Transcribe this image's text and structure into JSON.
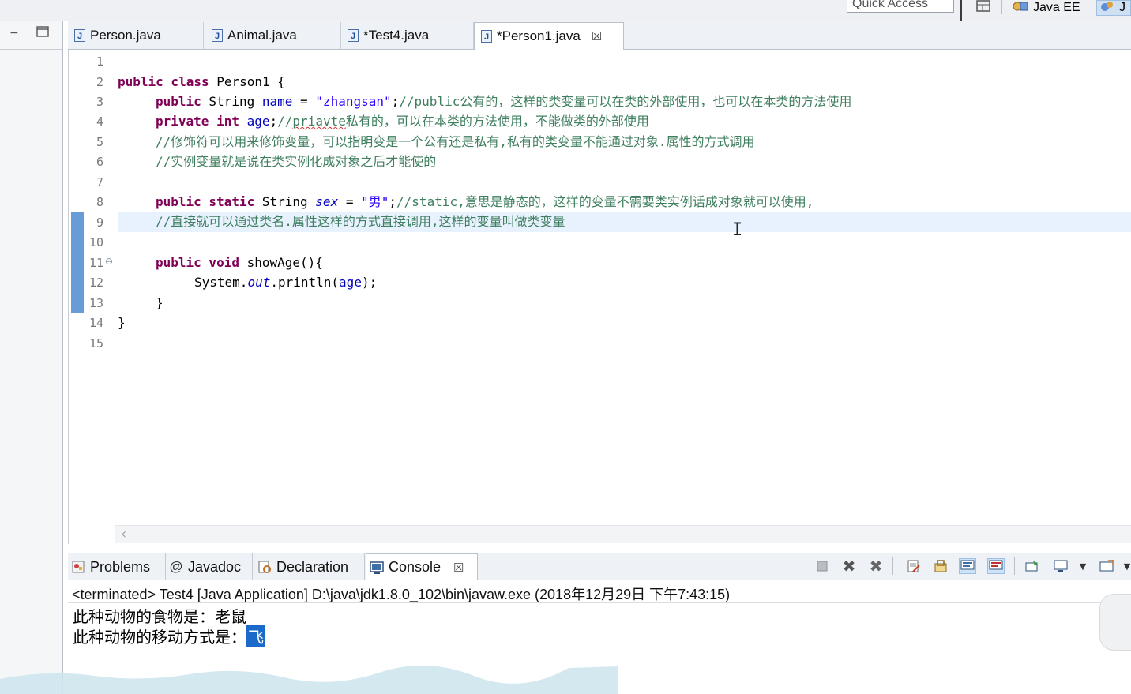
{
  "quick_access": {
    "label": "Quick Access"
  },
  "perspectives": {
    "java_ee": "Java EE",
    "more": "J"
  },
  "editor_tabs": [
    {
      "label": "Person.java",
      "active": false
    },
    {
      "label": "Animal.java",
      "active": false
    },
    {
      "label": "*Test4.java",
      "active": false
    },
    {
      "label": "*Person1.java",
      "active": true
    }
  ],
  "editor": {
    "line_numbers": [
      "1",
      "2",
      "3",
      "4",
      "5",
      "6",
      "7",
      "8",
      "9",
      "10",
      "11",
      "12",
      "13",
      "14",
      "15"
    ],
    "current_line": 9,
    "code": {
      "l2_kw": "public class",
      "l2_rest": " Person1 {",
      "l3_kw": "public",
      "l3_type": " String ",
      "l3_field": "name",
      "l3_eq": " = ",
      "l3_str": "\"zhangsan\"",
      "l3_semi": ";",
      "l3_cm": "//public公有的，这样的类变量可以在类的外部使用，也可以在本类的方法使用",
      "l4_kw": "private int",
      "l4_sp": " ",
      "l4_field": "age",
      "l4_semi": ";",
      "l4_cm1": "//",
      "l4_cm2": "priavte",
      "l4_cm3": "私有的，可以在本类的方法使用，不能做类的外部使用",
      "l5_cm": "//修饰符可以用来修饰变量，可以指明变是一个公有还是私有,私有的类变量不能通过对象.属性的方式调用",
      "l6_cm": "//实例变量就是说在类实例化成对象之后才能使的",
      "l8_kw": "public static",
      "l8_type": " String ",
      "l8_field": "sex",
      "l8_eq": " = ",
      "l8_str": "\"男\"",
      "l8_semi": ";",
      "l8_cm": "//static,意思是静态的，这样的变量不需要类实例话成对象就可以使用,",
      "l9_cm": "//直接就可以通过类名.属性这样的方式直接调用,这样的变量叫做类变量",
      "l11_kw": "public void",
      "l11_rest": " showAge(){",
      "l12_a": "System.",
      "l12_out": "out",
      "l12_b": ".println(",
      "l12_field": "age",
      "l12_c": ");",
      "l13": "}",
      "l14": "}"
    }
  },
  "console_tabs": [
    {
      "label": "Problems",
      "icon": "problems-icon"
    },
    {
      "label": "Javadoc",
      "icon": "at-icon"
    },
    {
      "label": "Declaration",
      "icon": "declaration-icon"
    },
    {
      "label": "Console",
      "icon": "console-icon",
      "active": true
    }
  ],
  "console": {
    "terminated_line": "<terminated> Test4 [Java Application] D:\\java\\jdk1.8.0_102\\bin\\javaw.exe (2018年12月29日 下午7:43:15)",
    "output_line1": "此种动物的食物是：老鼠",
    "output_line2_prefix": "此种动物的移动方式是：",
    "output_line2_selected": "飞"
  },
  "colors": {
    "keyword": "#7f0055",
    "string": "#2a00ff",
    "comment": "#3f7f5f",
    "field": "#0000c0",
    "current_line": "#e8f2fe",
    "diff_bar": "#4c8bd0"
  }
}
